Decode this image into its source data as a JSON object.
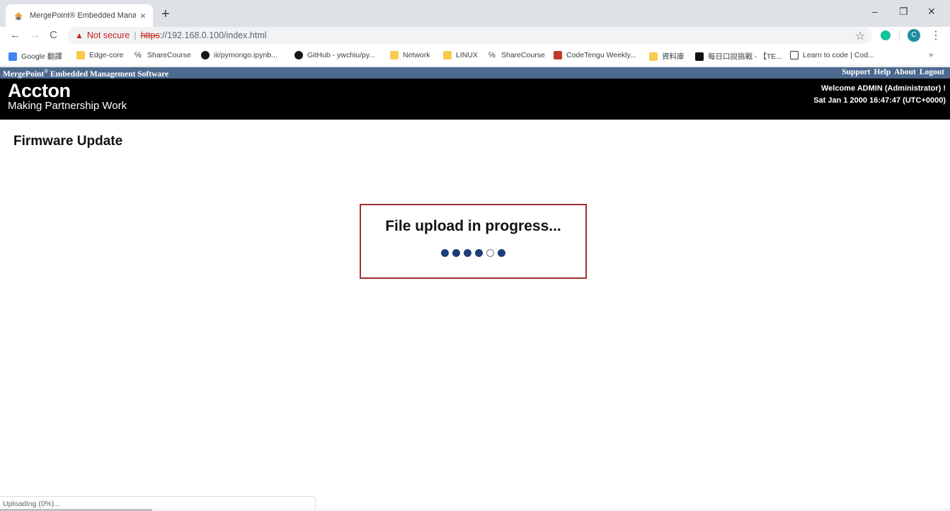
{
  "browser": {
    "tab_title": "MergePoint® Embedded Manag",
    "tab_close": "×",
    "new_tab": "+",
    "window_controls": {
      "minimize": "–",
      "restore": "❐",
      "close": "✕"
    },
    "nav": {
      "back": "←",
      "forward": "→",
      "reload": "C"
    },
    "omnibox": {
      "warning_icon": "▲",
      "not_secure": "Not secure",
      "separator": "|",
      "protocol": "https",
      "url_rest": "://192.168.0.100/index.html"
    },
    "star": "☆",
    "profile_letter": "C",
    "menu": "⋮",
    "bookmarks": [
      {
        "label": "Google 翻譯",
        "icon": "translate-icon",
        "color": "#4285f4"
      },
      {
        "label": "Edge-core",
        "icon": "folder-icon",
        "color": "#f9cb4c"
      },
      {
        "label": "ShareCourse",
        "icon": "sharecourse-icon",
        "color": "#333333"
      },
      {
        "label": "iii/pymongo.ipynb...",
        "icon": "github-icon",
        "color": "#181717"
      },
      {
        "label": "GitHub - ywchiu/py...",
        "icon": "github-icon",
        "color": "#181717"
      },
      {
        "label": "Network",
        "icon": "folder-icon",
        "color": "#f9cb4c"
      },
      {
        "label": "LINUX",
        "icon": "folder-icon",
        "color": "#f9cb4c"
      },
      {
        "label": "ShareCourse",
        "icon": "sharecourse-icon",
        "color": "#333333"
      },
      {
        "label": "CodeTengu Weekly...",
        "icon": "codetengu-icon",
        "color": "#c0392b"
      },
      {
        "label": "資料庫",
        "icon": "folder-icon",
        "color": "#f9cb4c"
      },
      {
        "label": "每日口說挑戰 - 【TE...",
        "icon": "play-icon",
        "color": "#111111"
      },
      {
        "label": "Learn to code | Cod...",
        "icon": "code-icon",
        "color": "#333333"
      }
    ],
    "bookmarks_more": "»",
    "status_text": "Uploading (0%)..."
  },
  "app": {
    "product_name": "MergePoint",
    "product_mark": "®",
    "product_suffix": " Embedded Management Software",
    "links": {
      "support": "Support",
      "help": "Help",
      "about": "About",
      "logout": "Logout"
    },
    "brand": "Accton",
    "tagline": "Making Partnership Work",
    "welcome": "Welcome ADMIN (Administrator) !",
    "datetime": "Sat Jan 1 2000 16:47:47 (UTC+0000)"
  },
  "page": {
    "title": "Firmware Update",
    "progress_message": "File upload in progress...",
    "progress_dots": 6,
    "active_dot_index": 4
  },
  "colors": {
    "header_bar": "#4d6a8f",
    "banner": "#000000",
    "dialog_border": "#a4302f",
    "dot": "#1e3d78"
  }
}
